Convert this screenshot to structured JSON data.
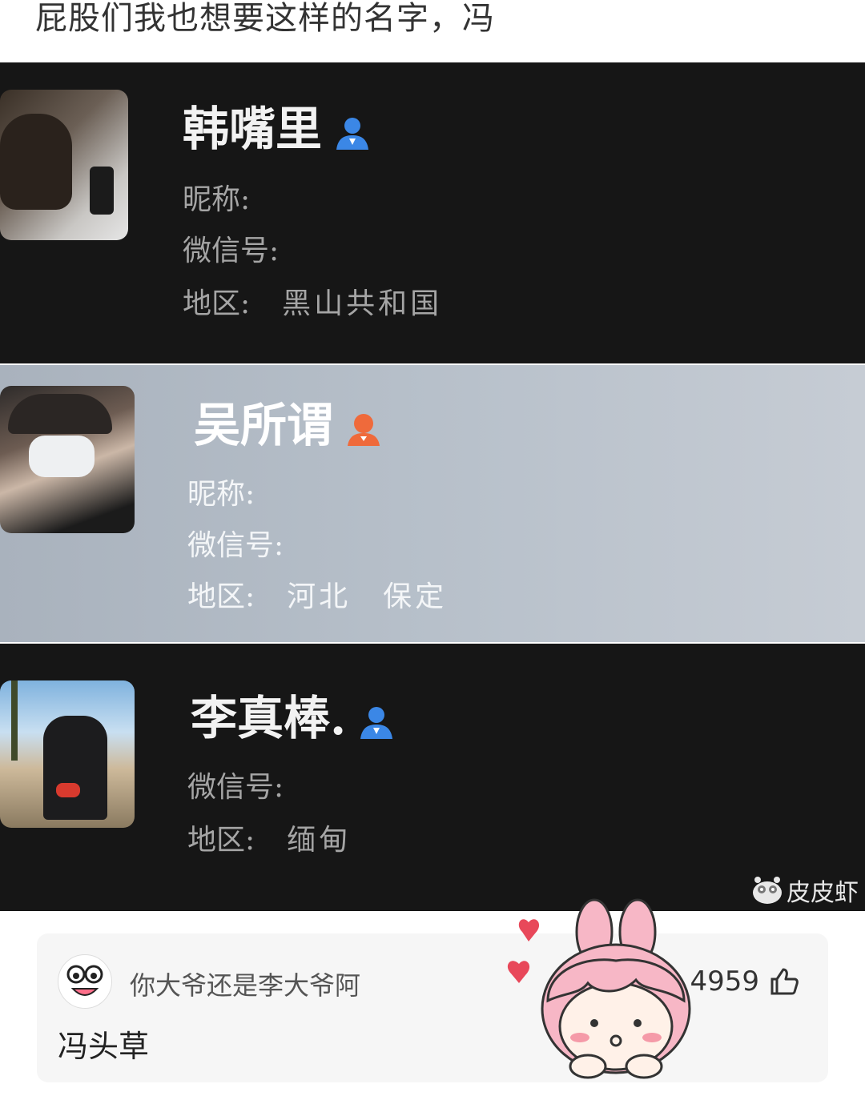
{
  "post": {
    "title": "屁股们我也想要这样的名字，冯"
  },
  "cards": [
    {
      "name": "韩嘴里",
      "gender": "male",
      "gender_color": "#3b87e6",
      "fields": [
        {
          "label": "昵称:",
          "value": ""
        },
        {
          "label": "微信号:",
          "value": ""
        },
        {
          "label": "地区:",
          "value": "黑山共和国"
        }
      ]
    },
    {
      "name": "吴所谓",
      "gender": "female",
      "gender_color": "#ef6a3b",
      "fields": [
        {
          "label": "昵称:",
          "value": ""
        },
        {
          "label": "微信号:",
          "value": ""
        },
        {
          "label": "地区:",
          "value": "河北　保定"
        }
      ]
    },
    {
      "name": "李真棒.",
      "gender": "male",
      "gender_color": "#3b87e6",
      "fields": [
        {
          "label": "微信号:",
          "value": ""
        },
        {
          "label": "地区:",
          "value": "缅甸"
        }
      ]
    }
  ],
  "watermark": {
    "text": "皮皮虾",
    "icon": "pipixia-logo-icon"
  },
  "comment": {
    "username": "你大爷还是李大爷阿",
    "text": "冯头草",
    "likes": "4959",
    "like_icon": "thumbs-up-icon"
  }
}
